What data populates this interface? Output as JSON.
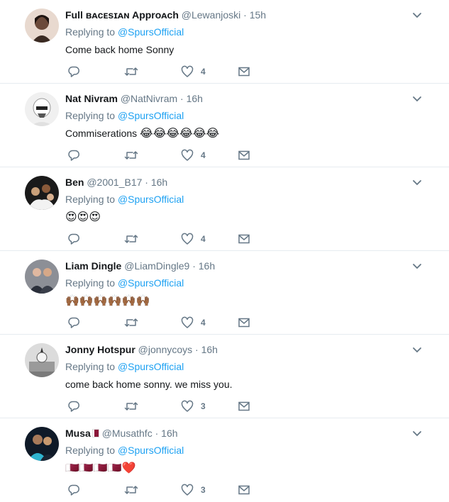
{
  "tweets": [
    {
      "name": "Full ʙᴀᴄᴇѕɪᴀɴ Approᴀch",
      "handle": "@Lewanjoski",
      "time": "15h",
      "replying_prefix": "Replying to",
      "replying_to": "@SpursOfficial",
      "text": "Come back home Sonny",
      "likes": "4",
      "avatar_color": "#3a2a22"
    },
    {
      "name": "Nat Nivram",
      "handle": "@NatNivram",
      "time": "16h",
      "replying_prefix": "Replying to",
      "replying_to": "@SpursOfficial",
      "text": "Commiserations",
      "text_emoji": "😂😂😂😂😂😂",
      "likes": "4",
      "avatar_color": "#d9d9d9"
    },
    {
      "name": "Ben",
      "handle": "@2001_B17",
      "time": "16h",
      "replying_prefix": "Replying to",
      "replying_to": "@SpursOfficial",
      "text": "",
      "text_emoji": "😍😍😍",
      "likes": "4",
      "avatar_color": "#2b2b2b"
    },
    {
      "name": "Liam Dingle",
      "handle": "@LiamDingle9",
      "time": "16h",
      "replying_prefix": "Replying to",
      "replying_to": "@SpursOfficial",
      "text": "",
      "text_emoji": "🙌🏾🙌🏾🙌🏾🙌🏾🙌🏾🙌🏾",
      "likes": "4",
      "avatar_color": "#4a4a5a"
    },
    {
      "name": "Jonny Hotspur",
      "handle": "@jonnycoys",
      "time": "16h",
      "replying_prefix": "Replying to",
      "replying_to": "@SpursOfficial",
      "text": "come back home sonny. we miss you.",
      "likes": "3",
      "avatar_color": "#c8c8c8"
    },
    {
      "name": "Musa",
      "handle": "@Musathfc",
      "time": "16h",
      "replying_prefix": "Replying to",
      "replying_to": "@SpursOfficial",
      "text": "",
      "text_emoji": "🇶🇦🇶🇦🇶🇦🇶🇦❤️",
      "likes": "3",
      "avatar_color": "#1d2a3a"
    }
  ],
  "colors": {
    "link": "#1da1f2",
    "muted": "#657786",
    "divider": "#e6ecf0"
  },
  "icons": {
    "reply": "reply-icon",
    "retweet": "retweet-icon",
    "like": "heart-icon",
    "dm": "envelope-icon",
    "caret": "chevron-down-icon"
  }
}
